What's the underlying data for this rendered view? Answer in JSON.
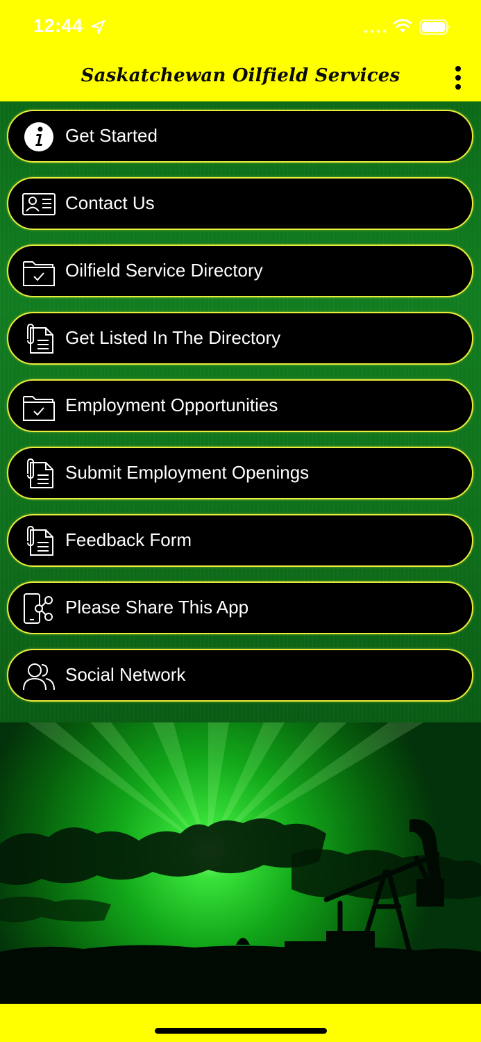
{
  "status_bar": {
    "time": "12:44",
    "icons": [
      "location-arrow-icon",
      "cellular-signal-icon",
      "wifi-icon",
      "battery-icon"
    ]
  },
  "app_bar": {
    "title": "Saskatchewan Oilfield Services",
    "overflow_icon": "vertical-ellipsis-icon"
  },
  "menu": {
    "items": [
      {
        "label": "Get Started",
        "icon": "info-icon"
      },
      {
        "label": "Contact Us",
        "icon": "contact-card-icon"
      },
      {
        "label": "Oilfield Service Directory",
        "icon": "folder-check-icon"
      },
      {
        "label": "Get Listed In The Directory",
        "icon": "document-clip-icon"
      },
      {
        "label": "Employment Opportunities",
        "icon": "folder-check-icon"
      },
      {
        "label": "Submit Employment Openings",
        "icon": "document-clip-icon"
      },
      {
        "label": "Feedback Form",
        "icon": "document-clip-icon"
      },
      {
        "label": "Please Share This App",
        "icon": "phone-share-icon"
      },
      {
        "label": "Social Network",
        "icon": "users-icon"
      }
    ]
  },
  "colors": {
    "accent_yellow": "#ffff00",
    "button_background": "#000000",
    "button_border": "#e9ee3a",
    "background_green": "#0f6f1b"
  },
  "hero_image": {
    "description_icon": "oil-pumpjack-sunset-image"
  }
}
